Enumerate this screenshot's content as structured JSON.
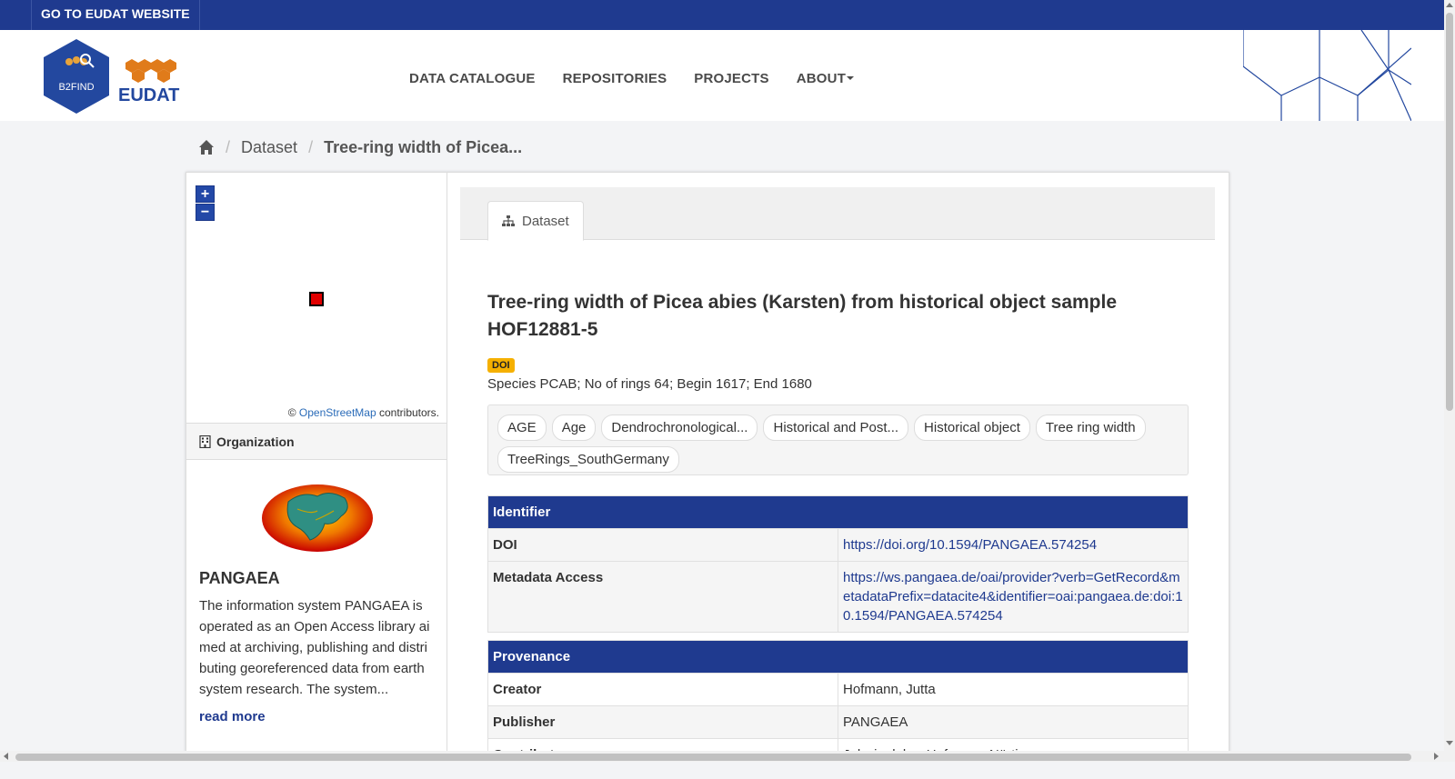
{
  "topbar": {
    "link": "GO TO EUDAT WEBSITE"
  },
  "header": {
    "logo_text_b2find": "B2FIND",
    "logo_text_eudat": "EUDAT",
    "nav": [
      "DATA CATALOGUE",
      "REPOSITORIES",
      "PROJECTS",
      "ABOUT"
    ]
  },
  "breadcrumb": {
    "home_icon": "home-icon",
    "items": [
      "Dataset",
      "Tree-ring width of Picea..."
    ]
  },
  "map": {
    "zoom_in": "+",
    "zoom_out": "−",
    "attribution_prefix": "©",
    "attribution_link": "OpenStreetMap",
    "attribution_suffix": "contributors."
  },
  "organization": {
    "heading": "Organization",
    "name": "PANGAEA",
    "description": "The information system PANGAEA is operated as an Open Access library aimed at archiving, publishing and distributing georeferenced data from earth system research. The system...",
    "read_more": "read more"
  },
  "tabs": [
    {
      "label": "Dataset",
      "icon": "sitemap-icon"
    }
  ],
  "dataset": {
    "title": "Tree-ring width of Picea abies (Karsten) from historical object sample HOF12881-5",
    "badge": "DOI",
    "subtitle": "Species PCAB; No of rings 64; Begin 1617; End 1680",
    "tags": [
      "AGE",
      "Age",
      "Dendrochronological...",
      "Historical and Post...",
      "Historical object",
      "Tree ring width",
      "TreeRings_SouthGermany"
    ]
  },
  "identifier": {
    "heading": "Identifier",
    "rows": [
      {
        "key": "DOI",
        "value": "https://doi.org/10.1594/PANGAEA.574254"
      },
      {
        "key": "Metadata Access",
        "value": "https://ws.pangaea.de/oai/provider?verb=GetRecord&metadataPrefix=datacite4&identifier=oai:pangaea.de:doi:10.1594/PANGAEA.574254"
      }
    ]
  },
  "provenance": {
    "heading": "Provenance",
    "rows": [
      {
        "key": "Creator",
        "value": "Hofmann, Jutta"
      },
      {
        "key": "Publisher",
        "value": "PANGAEA"
      },
      {
        "key": "Contributor",
        "value": "Jahrringlabor Hofmann, Nürtingen"
      }
    ]
  },
  "colors": {
    "brand": "#1f3a8f",
    "badge": "#f5b000",
    "marker": "#e10000"
  }
}
